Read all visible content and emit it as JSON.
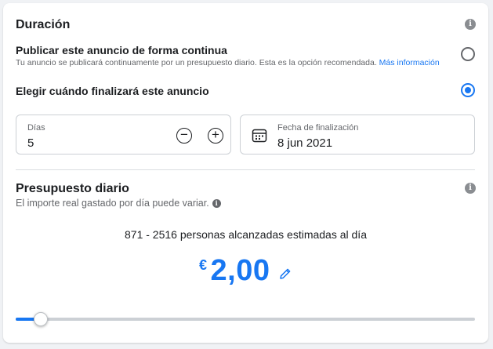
{
  "duration": {
    "title": "Duración",
    "option_continuous": {
      "label": "Publicar este anuncio de forma continua",
      "description": "Tu anuncio se publicará continuamente por un presupuesto diario. Esta es la opción recomendada.",
      "link": "Más información",
      "selected": false
    },
    "option_end_date": {
      "label": "Elegir cuándo finalizará este anuncio",
      "selected": true
    },
    "days": {
      "label": "Días",
      "value": "5",
      "decrement": "−",
      "increment": "+"
    },
    "end_date": {
      "label": "Fecha de finalización",
      "value": "8 jun 2021"
    }
  },
  "budget": {
    "title": "Presupuesto diario",
    "subtitle": "El importe real gastado por día puede variar.",
    "reach": "871 - 2516 personas alcanzadas estimadas al día",
    "currency": "€",
    "amount": "2,00",
    "slider_fraction": 0.055
  },
  "colors": {
    "accent": "#1877f2",
    "text": "#1c1e21",
    "secondary": "#65676b",
    "border": "#ccd0d5",
    "background": "#f0f2f5"
  },
  "icons": [
    "info-icon",
    "minus-circle-icon",
    "plus-circle-icon",
    "calendar-icon",
    "pencil-icon"
  ]
}
